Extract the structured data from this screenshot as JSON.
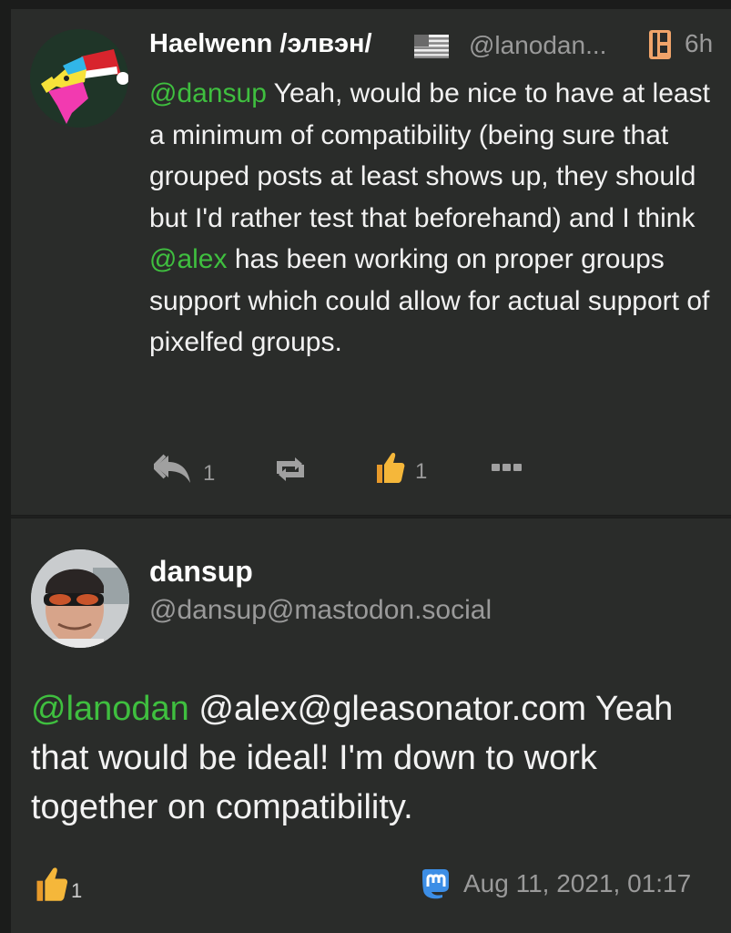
{
  "post1": {
    "author": "Haelwenn /элвэн/",
    "handle": "@lanodan...",
    "time": "6h",
    "body": {
      "mention1": "@dansup",
      "text1": " Yeah, would be nice to have at least a minimum of compatibility (being sure that grouped posts at least shows up, they should but I'd rather test that beforehand) and I think ",
      "mention2": "@alex",
      "text2": " has been working on proper groups support which could allow for actual support of pixelfed groups."
    },
    "actions": {
      "reply_count": "1",
      "like_count": "1"
    }
  },
  "post2": {
    "author": "dansup",
    "handle": "@dansup@mastodon.social",
    "body": {
      "mention1": "@lanodan",
      "text1": " @alex@gleasonator.com Yeah that would be ideal! I'm down to work together on compatibility."
    },
    "like_count": "1",
    "date": "Aug 11, 2021, 01:17"
  },
  "icons": {
    "reply": "reply-icon",
    "boost": "boost-icon",
    "like": "thumbs-up-icon",
    "more": "more-icon",
    "bookmark": "bookmark-icon",
    "flag": "us-flag-icon",
    "mastodon": "mastodon-icon"
  },
  "colors": {
    "mention": "#3fbf3f",
    "thumb": "#f5b73a",
    "background": "#2a2c2a"
  }
}
